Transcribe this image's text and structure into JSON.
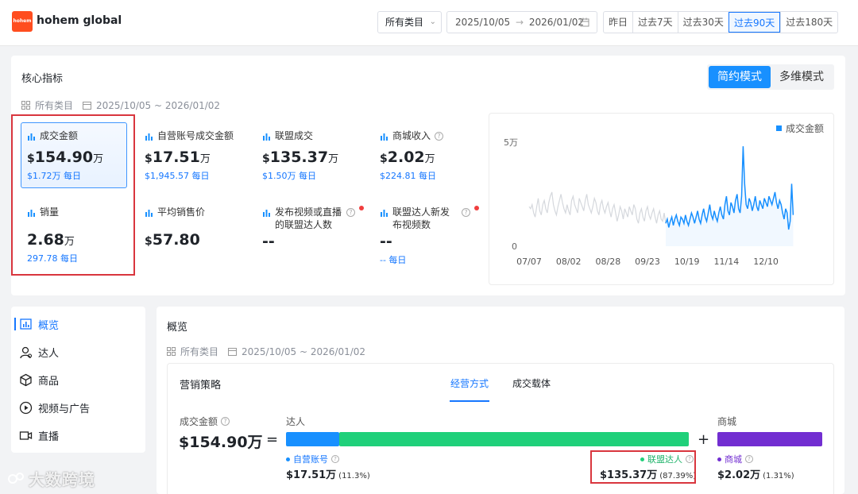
{
  "brand": {
    "logo_text": "hohem",
    "name": "hohem global"
  },
  "filters": {
    "category": "所有类目",
    "date_start": "2025/10/05",
    "date_end": "2026/01/02",
    "date_arrow": "→",
    "ranges": [
      "昨日",
      "过去7天",
      "过去30天",
      "过去90天",
      "过去180天"
    ],
    "active_range": "过去90天"
  },
  "core": {
    "title": "核心指标",
    "meta_category": "所有类目",
    "meta_date": "2025/10/05 ~ 2026/01/02",
    "modes": [
      "简约模式",
      "多维模式"
    ],
    "active_mode": "简约模式",
    "metrics": [
      {
        "label": "成交金额",
        "currency": "$",
        "value": "154.90",
        "unit": "万",
        "sub": "$1.72万 每日",
        "active": true
      },
      {
        "label": "自营账号成交金额",
        "currency": "$",
        "value": "17.51",
        "unit": "万",
        "sub": "$1,945.57 每日"
      },
      {
        "label": "联盟成交",
        "currency": "$",
        "value": "135.37",
        "unit": "万",
        "sub": "$1.50万 每日"
      },
      {
        "label": "商城收入",
        "currency": "$",
        "value": "2.02",
        "unit": "万",
        "sub": "$224.81 每日",
        "help": true
      },
      {
        "label": "销量",
        "currency": "",
        "value": "2.68",
        "unit": "万",
        "sub": "297.78 每日"
      },
      {
        "label": "平均销售价",
        "currency": "$",
        "value": "57.80",
        "unit": "",
        "sub": ""
      },
      {
        "label": "发布视频或直播的联盟达人数",
        "currency": "",
        "value": "--",
        "unit": "",
        "sub": "",
        "help": true,
        "alert": true
      },
      {
        "label": "联盟达人新发布视频数",
        "currency": "",
        "value": "--",
        "unit": "",
        "sub": "-- 每日",
        "help": true,
        "alert": true
      }
    ]
  },
  "chart_data": {
    "type": "line",
    "legend": [
      "成交金额"
    ],
    "y_ticks": [
      "5万",
      "0"
    ],
    "ylim": [
      0,
      50000
    ],
    "x_ticks": [
      "07/07",
      "08/02",
      "08/28",
      "09/23",
      "10/19",
      "11/14",
      "12/10"
    ],
    "x_range": [
      "2025/07/07",
      "2026/01/02"
    ],
    "highlight_start": "2025/10/05",
    "colors": {
      "context": "#d5d8dd",
      "active": "#1890ff"
    },
    "series": [
      {
        "name": "成交金额",
        "x_start": "2025/07/07",
        "step_days": 1,
        "values": [
          19000,
          18000,
          20000,
          16000,
          14000,
          19000,
          23000,
          17000,
          15000,
          20000,
          22000,
          18000,
          16000,
          21000,
          24000,
          26000,
          20000,
          17000,
          15000,
          19000,
          22000,
          25000,
          21000,
          18000,
          16000,
          20000,
          17000,
          15000,
          22000,
          24000,
          20000,
          18000,
          16000,
          23000,
          21000,
          19000,
          17000,
          22000,
          25000,
          20000,
          18000,
          16000,
          19000,
          23000,
          21000,
          17000,
          15000,
          20000,
          22000,
          18000,
          16000,
          19000,
          21000,
          17000,
          14000,
          18000,
          20000,
          16000,
          12000,
          15000,
          19000,
          17000,
          13000,
          18000,
          16000,
          14000,
          19000,
          17000,
          15000,
          20000,
          18000,
          13000,
          11000,
          16000,
          18000,
          14000,
          12000,
          17000,
          19000,
          15000,
          13000,
          16000,
          18000,
          14000,
          11000,
          15000,
          17000,
          13000,
          12000,
          16000,
          11000,
          13000,
          9000,
          12000,
          14000,
          10000,
          13000,
          15000,
          12000,
          10000,
          14000,
          13000,
          11000,
          15000,
          12000,
          10000,
          13000,
          16000,
          14000,
          11000,
          14000,
          17000,
          13000,
          11000,
          15000,
          18000,
          14000,
          12000,
          16000,
          20000,
          15000,
          13000,
          17000,
          14000,
          12000,
          16000,
          19000,
          15000,
          13000,
          20000,
          24000,
          17000,
          15000,
          21000,
          19000,
          16000,
          22000,
          25000,
          18000,
          16000,
          24000,
          48000,
          30000,
          20000,
          18000,
          23000,
          21000,
          17000,
          20000,
          24000,
          19000,
          17000,
          22000,
          20000,
          18000,
          23000,
          21000,
          19000,
          24000,
          22000,
          20000,
          23000,
          26000,
          21000,
          18000,
          22000,
          20000,
          16000,
          13000,
          18000,
          16000,
          8000,
          12000,
          30000,
          15000
        ]
      }
    ]
  },
  "sidebar": {
    "items": [
      "概览",
      "达人",
      "商品",
      "视频与广告",
      "直播"
    ],
    "active": "概览"
  },
  "overview": {
    "title": "概览",
    "meta_category": "所有类目",
    "meta_date": "2025/10/05 ~ 2026/01/02",
    "strategy_title": "营销策略",
    "tabs": [
      "经营方式",
      "成交载体"
    ],
    "active_tab": "经营方式",
    "total_label": "成交金额",
    "total_value": "$154.90万",
    "eq": "=",
    "plus": "+",
    "group_creators": "达人",
    "group_mall": "商城",
    "breakdown": [
      {
        "name": "自营账号",
        "value": "$17.51万",
        "pct": "(11.3%)",
        "share": 0.113,
        "color": "#1890ff"
      },
      {
        "name": "联盟达人",
        "value": "$135.37万",
        "pct": "(87.39%)",
        "share": 0.8739,
        "color": "#1fd07a"
      },
      {
        "name": "商城",
        "value": "$2.02万",
        "pct": "(1.31%)",
        "share": 0.0131,
        "color": "#722ed1"
      }
    ]
  },
  "watermark": "大数跨境"
}
